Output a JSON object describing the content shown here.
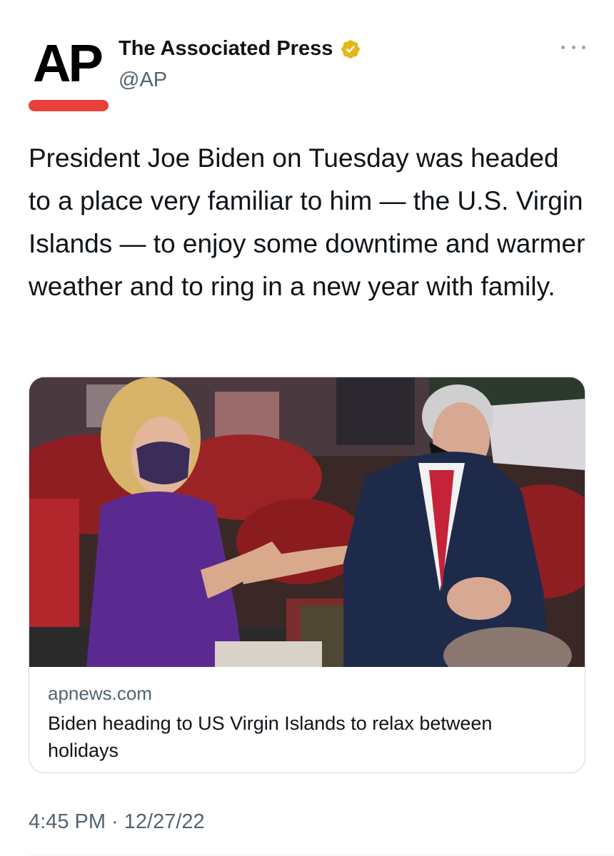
{
  "tweet": {
    "author": {
      "display_name": "The Associated Press",
      "handle": "@AP",
      "avatar_text": "AP",
      "verified_badge": "gold"
    },
    "text": "President Joe Biden on Tuesday was headed to a place very familiar to him — the U.S. Virgin Islands — to enjoy some downtime and warmer weather and to ring in a new year with family.",
    "link_card": {
      "domain": "apnews.com",
      "title": "Biden heading to US Virgin Islands to relax between holidays"
    },
    "timestamp": "4:45 PM · 12/27/22"
  },
  "icons": {
    "verified": "verified-badge-icon",
    "more": "more-options-icon"
  },
  "colors": {
    "ap_red": "#e8413b",
    "verified_gold": "#e2b719",
    "secondary_text": "#536471",
    "primary_text": "#0f1419",
    "card_border": "#cfd9de"
  }
}
